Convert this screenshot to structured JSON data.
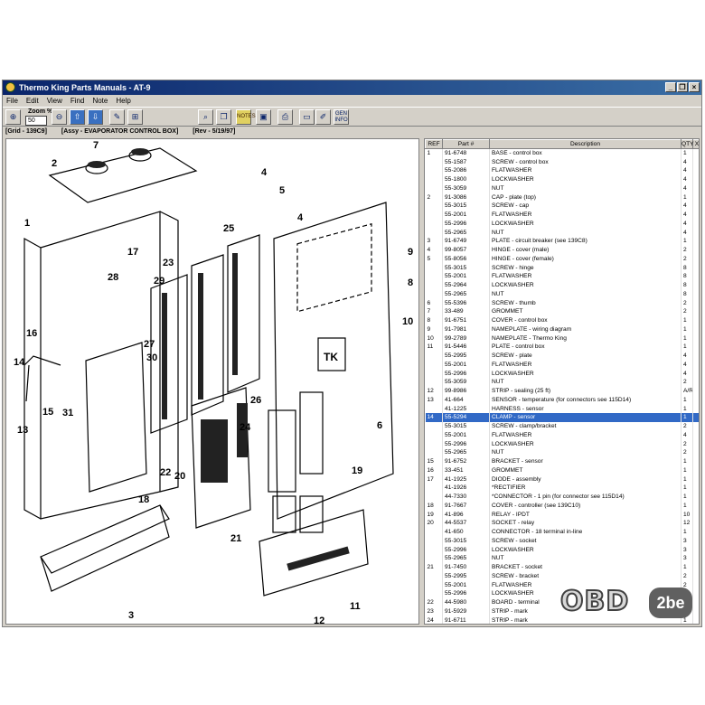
{
  "window": {
    "title": "Thermo King Parts Manuals - AT-9"
  },
  "menu": [
    "File",
    "Edit",
    "View",
    "Find",
    "Note",
    "Help"
  ],
  "toolbar": {
    "zoom_label": "Zoom %",
    "zoom_value": "50",
    "notes_label": "NOTES",
    "gen_info_label": "GEN INFO"
  },
  "info": {
    "grid": "[Grid - 139C9]",
    "assy": "[Assy - EVAPORATOR CONTROL BOX]",
    "rev": "[Rev - 5/19/97]"
  },
  "columns": [
    "REF",
    "Part #",
    "Description",
    "QTY",
    "X"
  ],
  "selected_row": 30,
  "rows": [
    [
      "1",
      "91-6748",
      "BASE - control box",
      "1"
    ],
    [
      "",
      "55-1587",
      "SCREW - control box",
      "4"
    ],
    [
      "",
      "55-2086",
      "FLATWASHER",
      "4"
    ],
    [
      "",
      "55-1800",
      "LOCKWASHER",
      "4"
    ],
    [
      "",
      "55-3059",
      "NUT",
      "4"
    ],
    [
      "2",
      "91-3086",
      "CAP - plate (top)",
      "1"
    ],
    [
      "",
      "55-3015",
      "SCREW - cap",
      "4"
    ],
    [
      "",
      "55-2001",
      "FLATWASHER",
      "4"
    ],
    [
      "",
      "55-2996",
      "LOCKWASHER",
      "4"
    ],
    [
      "",
      "55-2965",
      "NUT",
      "4"
    ],
    [
      "3",
      "91-6749",
      "PLATE - circuit breaker (see 139C8)",
      "1"
    ],
    [
      "4",
      "99-8057",
      "HINGE - cover (male)",
      "2"
    ],
    [
      "5",
      "55-8056",
      "HINGE - cover (female)",
      "2"
    ],
    [
      "",
      "55-3015",
      "SCREW - hinge",
      "8"
    ],
    [
      "",
      "55-2001",
      "FLATWASHER",
      "8"
    ],
    [
      "",
      "55-2964",
      "LOCKWASHER",
      "8"
    ],
    [
      "",
      "55-2965",
      "NUT",
      "8"
    ],
    [
      "6",
      "55-5396",
      "SCREW - thumb",
      "2"
    ],
    [
      "7",
      "33-489",
      "GROMMET",
      "2"
    ],
    [
      "8",
      "91-6751",
      "COVER - control box",
      "1"
    ],
    [
      "9",
      "91-7981",
      "NAMEPLATE - wiring diagram",
      "1"
    ],
    [
      "10",
      "99-2789",
      "NAMEPLATE - Thermo King",
      "1"
    ],
    [
      "11",
      "91-5446",
      "PLATE - control box",
      "1"
    ],
    [
      "",
      "55-2995",
      "SCREW - plate",
      "4"
    ],
    [
      "",
      "55-2001",
      "FLATWASHER",
      "4"
    ],
    [
      "",
      "55-2996",
      "LOCKWASHER",
      "4"
    ],
    [
      "",
      "55-3059",
      "NUT",
      "2"
    ],
    [
      "12",
      "99-8986",
      "STRIP - sealing (25 ft)",
      "A/R"
    ],
    [
      "13",
      "41-664",
      "SENSOR - temperature (for connectors  see 115D14)",
      "1"
    ],
    [
      "",
      "41-1225",
      "HARNESS - sensor",
      "1"
    ],
    [
      "14",
      "55-5294",
      "CLAMP - sensor",
      "1"
    ],
    [
      "",
      "55-3015",
      "SCREW - clamp/bracket",
      "2"
    ],
    [
      "",
      "55-2001",
      "FLATWASHER",
      "4"
    ],
    [
      "",
      "55-2996",
      "LOCKWASHER",
      "2"
    ],
    [
      "",
      "55-2965",
      "NUT",
      "2"
    ],
    [
      "15",
      "91-6752",
      "BRACKET - sensor",
      "1"
    ],
    [
      "16",
      "33-451",
      "GROMMET",
      "1"
    ],
    [
      "17",
      "41-1925",
      "DIODE - assembly",
      "1"
    ],
    [
      "",
      "41-1926",
      "*RECTIFIER",
      "1"
    ],
    [
      "",
      "44-7330",
      "*CONNECTOR - 1 pin (for connector  see 115D14)",
      "1"
    ],
    [
      "18",
      "91-7667",
      "COVER - controller  (see 139C10)",
      "1"
    ],
    [
      "19",
      "41-896",
      "RELAY - IPDT",
      "10"
    ],
    [
      "20",
      "44-5537",
      "SOCKET - relay",
      "12"
    ],
    [
      "",
      "41-650",
      "CONNECTOR - 18 terminal in-line",
      "1"
    ],
    [
      "",
      "55-3015",
      "SCREW - socket",
      "3"
    ],
    [
      "",
      "55-2996",
      "LOCKWASHER",
      "3"
    ],
    [
      "",
      "55-2965",
      "NUT",
      "3"
    ],
    [
      "21",
      "91-7450",
      "BRACKET - socket",
      "1"
    ],
    [
      "",
      "55-2995",
      "SCREW - bracket",
      "2"
    ],
    [
      "",
      "55-2001",
      "FLATWASHER",
      "2"
    ],
    [
      "",
      "55-2996",
      "LOCKWASHER",
      "2"
    ],
    [
      "22",
      "44-5980",
      "BOARD - terminal",
      "2"
    ],
    [
      "23",
      "91-5929",
      "STRIP - mark",
      "1"
    ],
    [
      "24",
      "91-6711",
      "STRIP - mark",
      "1"
    ]
  ],
  "callouts": [
    "1",
    "2",
    "3",
    "4",
    "4",
    "5",
    "6",
    "7",
    "8",
    "9",
    "10",
    "11",
    "12",
    "13",
    "14",
    "15",
    "16",
    "17",
    "18",
    "19",
    "20",
    "21",
    "22",
    "23",
    "24",
    "25",
    "26",
    "27",
    "28",
    "29",
    "30",
    "31"
  ],
  "drawing_marks": {
    "nameplate_logo": "TK"
  },
  "watermark": {
    "text": "OBD",
    "badge": "2be"
  }
}
